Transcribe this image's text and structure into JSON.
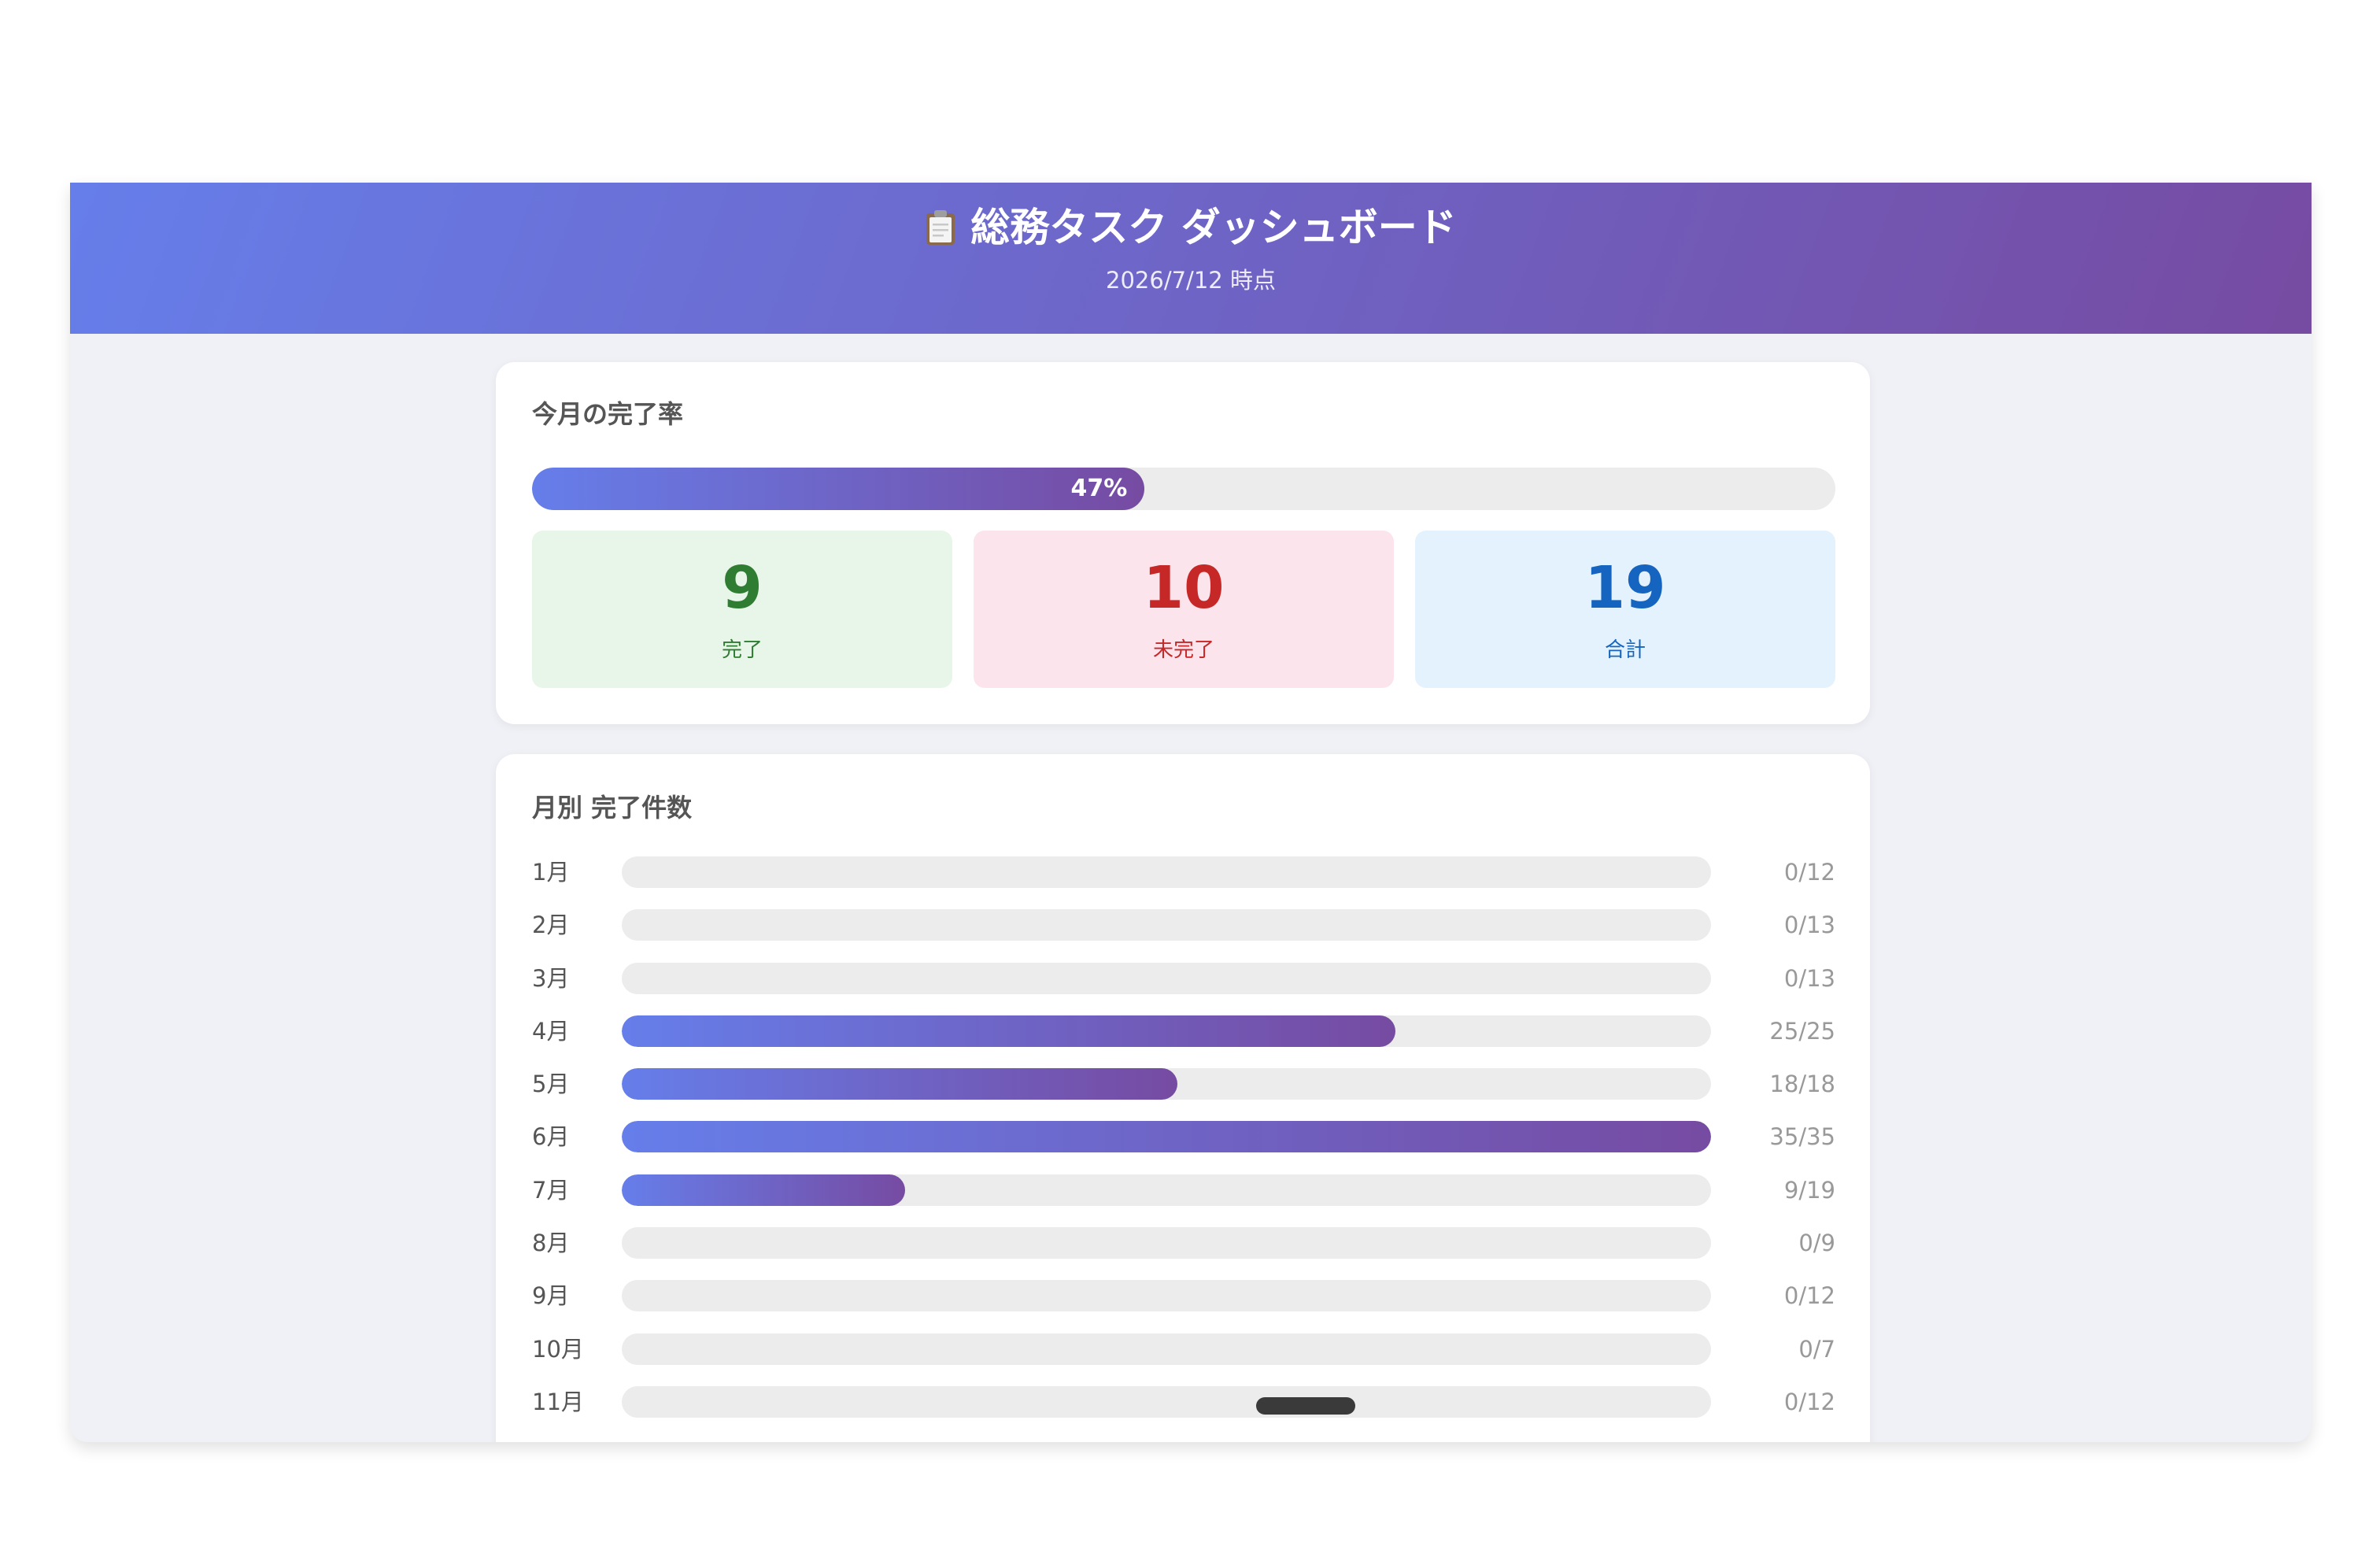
{
  "header": {
    "icon": "clipboard-icon",
    "title": "総務タスク ダッシュボード",
    "subtitle": "2026/7/12 時点"
  },
  "completion": {
    "title": "今月の完了率",
    "percent": 47,
    "percent_label": "47%",
    "stats": {
      "done": {
        "value": "9",
        "label": "完了"
      },
      "undone": {
        "value": "10",
        "label": "未完了"
      },
      "total": {
        "value": "19",
        "label": "合計"
      }
    }
  },
  "monthly": {
    "title": "月別 完了件数",
    "months": [
      {
        "label": "1月",
        "count": "0/12",
        "ratio": 0
      },
      {
        "label": "2月",
        "count": "0/13",
        "ratio": 0
      },
      {
        "label": "3月",
        "count": "0/13",
        "ratio": 0
      },
      {
        "label": "4月",
        "count": "25/25",
        "ratio": 0.71
      },
      {
        "label": "5月",
        "count": "18/18",
        "ratio": 0.51
      },
      {
        "label": "6月",
        "count": "35/35",
        "ratio": 1.0
      },
      {
        "label": "7月",
        "count": "9/19",
        "ratio": 0.26
      },
      {
        "label": "8月",
        "count": "0/9",
        "ratio": 0
      },
      {
        "label": "9月",
        "count": "0/12",
        "ratio": 0
      },
      {
        "label": "10月",
        "count": "0/7",
        "ratio": 0
      },
      {
        "label": "11月",
        "count": "0/12",
        "ratio": 0
      }
    ]
  },
  "colors": {
    "gradient_start": "#667eea",
    "gradient_end": "#764ba2",
    "done": "#2e7d32",
    "undone": "#c62828",
    "total": "#1565c0"
  }
}
